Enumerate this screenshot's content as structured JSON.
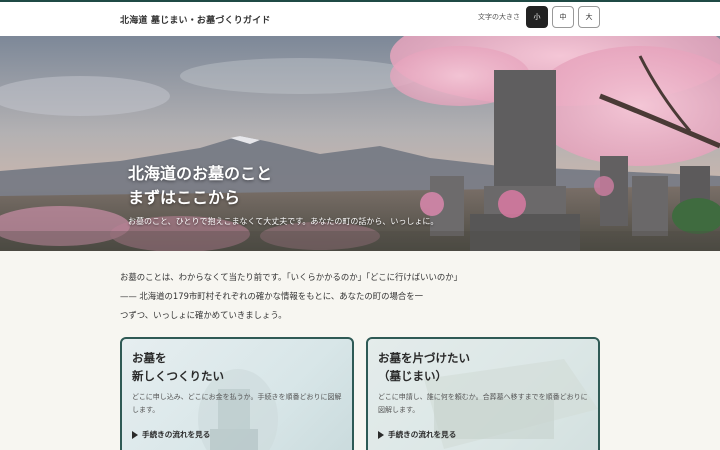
{
  "header": {
    "site_title": "北海道 墓じまい・お墓づくりガイド",
    "font_size_label": "文字の大きさ",
    "font_sizes": [
      {
        "label": "小",
        "active": true
      },
      {
        "label": "中",
        "active": false
      },
      {
        "label": "大",
        "active": false
      }
    ]
  },
  "hero": {
    "title_line1": "北海道のお墓のこと",
    "title_line2": "まずはここから",
    "subtitle": "お墓のこと、ひとりで抱えこまなくて大丈夫です。あなたの町の話から、いっしょに。"
  },
  "intro": {
    "line1": "お墓のことは、わからなくて当たり前です。「いくらかかるのか」「どこに行けばいいのか」",
    "line2": "—— 北海道の179市町村それぞれの確かな情報をもとに、あなたの町の場合を一",
    "line3": "つずつ、いっしょに確かめていきましょう。"
  },
  "cards": [
    {
      "title_line1": "お墓を",
      "title_line2": "新しくつくりたい",
      "description": "どこに申し込み、どこにお金を払うか。手続きを順番どおりに図解します。",
      "link": "手続きの流れを見る"
    },
    {
      "title_line1": "お墓を片づけたい",
      "title_line2": "（墓じまい）",
      "description": "どこに申請し、誰に何を頼むか。合葬墓へ移すまでを順番どおりに図解します。",
      "link": "手続きの流れを見る"
    }
  ],
  "colors": {
    "accent": "#1f4a45",
    "card_border": "#2f5a55"
  }
}
